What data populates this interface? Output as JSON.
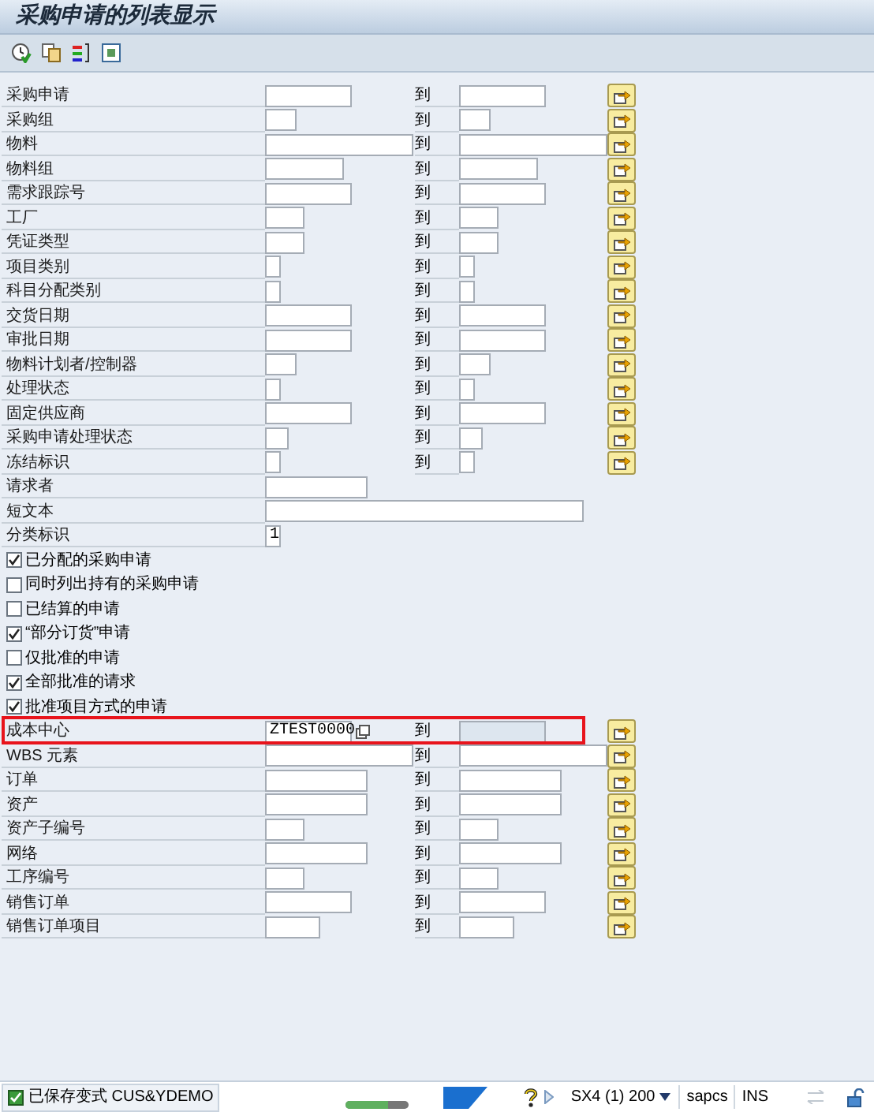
{
  "title": "采购申请的列表显示",
  "rows": [
    {
      "kind": "range",
      "label": "采购申请",
      "to_label": "到",
      "to_disabled": false,
      "highlighted": false
    },
    {
      "kind": "range",
      "label": "采购组",
      "to_label": "到",
      "to_disabled": false,
      "highlighted": false
    },
    {
      "kind": "range",
      "label": "物料",
      "to_label": "到",
      "to_disabled": false,
      "highlighted": false
    },
    {
      "kind": "range",
      "label": "物料组",
      "to_label": "到",
      "to_disabled": false,
      "highlighted": false
    },
    {
      "kind": "range",
      "label": "需求跟踪号",
      "to_label": "到",
      "to_disabled": false,
      "highlighted": false
    },
    {
      "kind": "range",
      "label": "工厂",
      "to_label": "到",
      "to_disabled": false,
      "highlighted": false
    },
    {
      "kind": "range",
      "label": "凭证类型",
      "to_label": "到",
      "to_disabled": false,
      "highlighted": false
    },
    {
      "kind": "range",
      "label": "项目类别",
      "to_label": "到",
      "to_disabled": false,
      "highlighted": false
    },
    {
      "kind": "range",
      "label": "科目分配类别",
      "to_label": "到",
      "to_disabled": false,
      "highlighted": false
    },
    {
      "kind": "range",
      "label": "交货日期",
      "to_label": "到",
      "to_disabled": false,
      "highlighted": false
    },
    {
      "kind": "range",
      "label": "审批日期",
      "to_label": "到",
      "to_disabled": false,
      "highlighted": false
    },
    {
      "kind": "range",
      "label": "物料计划者/控制器",
      "to_label": "到",
      "to_disabled": false,
      "highlighted": false
    },
    {
      "kind": "range",
      "label": "处理状态",
      "to_label": "到",
      "to_disabled": false,
      "highlighted": false
    },
    {
      "kind": "range",
      "label": "固定供应商",
      "to_label": "到",
      "to_disabled": false,
      "highlighted": false
    },
    {
      "kind": "range",
      "label": "采购申请处理状态",
      "to_label": "到",
      "to_disabled": false,
      "highlighted": false
    },
    {
      "kind": "range",
      "label": "冻结标识",
      "to_label": "到",
      "to_disabled": false,
      "highlighted": false
    },
    {
      "kind": "single",
      "label": "请求者"
    },
    {
      "kind": "single",
      "label": "短文本"
    },
    {
      "kind": "single",
      "label": "分类标识",
      "value": "1"
    },
    {
      "kind": "checkbox",
      "label": "已分配的采购申请",
      "checked": true
    },
    {
      "kind": "checkbox",
      "label": "同时列出持有的采购申请",
      "checked": false
    },
    {
      "kind": "checkbox",
      "label": "已结算的申请",
      "checked": false
    },
    {
      "kind": "checkbox",
      "label": "“部分订货”申请",
      "checked": true
    },
    {
      "kind": "checkbox",
      "label": "仅批准的申请",
      "checked": false
    },
    {
      "kind": "checkbox",
      "label": "全部批准的请求",
      "checked": true
    },
    {
      "kind": "checkbox",
      "label": "批准项目方式的申请",
      "checked": true
    },
    {
      "kind": "range",
      "label": "成本中心",
      "value": "ZTEST0000",
      "to_label": "到",
      "to_disabled": true,
      "highlighted": true
    },
    {
      "kind": "range",
      "label": "WBS 元素",
      "to_label": "到",
      "to_disabled": false,
      "highlighted": false
    },
    {
      "kind": "range",
      "label": "订单",
      "to_label": "到",
      "to_disabled": false,
      "highlighted": false
    },
    {
      "kind": "range",
      "label": "资产",
      "to_label": "到",
      "to_disabled": false,
      "highlighted": false
    },
    {
      "kind": "range",
      "label": "资产子编号",
      "to_label": "到",
      "to_disabled": false,
      "highlighted": false
    },
    {
      "kind": "range",
      "label": "网络",
      "to_label": "到",
      "to_disabled": false,
      "highlighted": false
    },
    {
      "kind": "range",
      "label": "工序编号",
      "to_label": "到",
      "to_disabled": false,
      "highlighted": false
    },
    {
      "kind": "range",
      "label": "销售订单",
      "to_label": "到",
      "to_disabled": false,
      "highlighted": false
    },
    {
      "kind": "range",
      "label": "销售订单项目",
      "to_label": "到",
      "to_disabled": false,
      "highlighted": false
    }
  ],
  "status_bar": {
    "message": "已保存变式 CUS&YDEMO",
    "system": "SX4 (1) 200",
    "server": "sapcs",
    "mode": "INS"
  }
}
